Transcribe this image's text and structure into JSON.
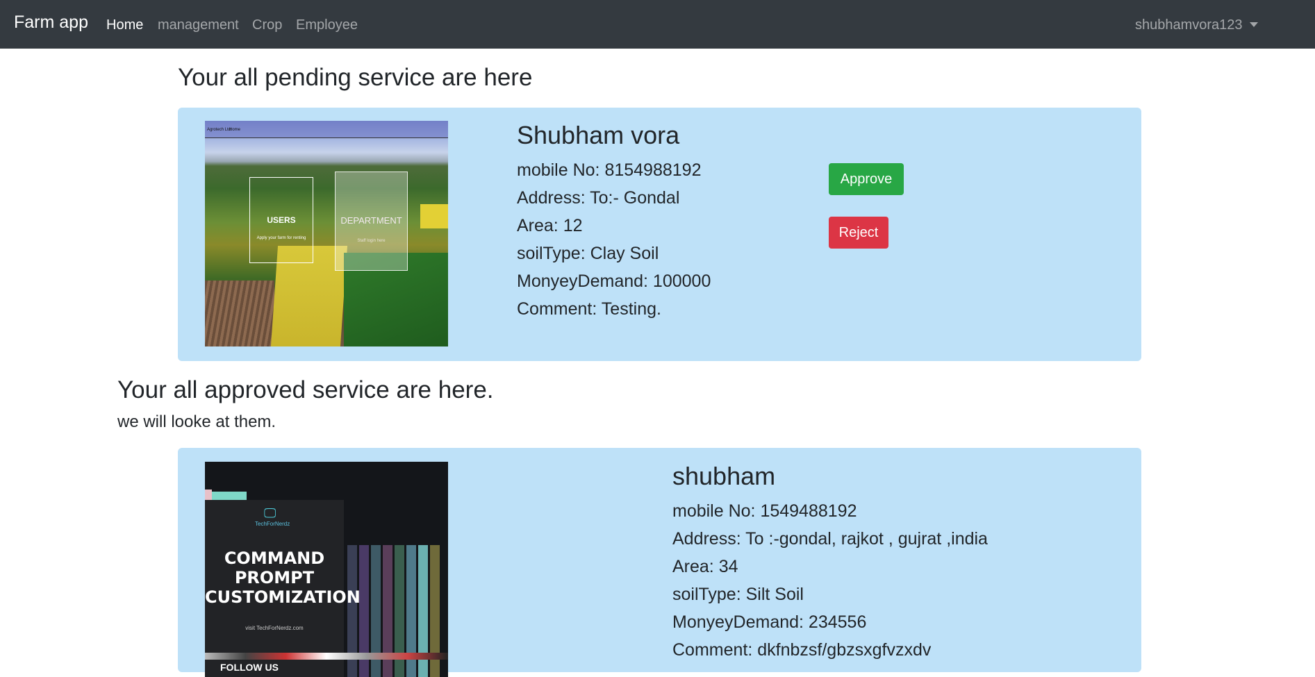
{
  "navbar": {
    "brand": "Farm app",
    "links": [
      {
        "label": "Home",
        "active": true
      },
      {
        "label": "management",
        "active": false
      },
      {
        "label": "Crop",
        "active": false
      },
      {
        "label": "Employee",
        "active": false
      }
    ],
    "user": "shubhamvora123"
  },
  "pending": {
    "heading": "Your all pending service are here",
    "items": [
      {
        "name": "Shubham vora",
        "mobile": "mobile No: 8154988192",
        "address": "Address: To:- Gondal",
        "area": "Area: 12",
        "soil": "soilType: Clay Soil",
        "money": "MonyeyDemand: 100000",
        "comment": "Comment: Testing.",
        "approve_label": "Approve",
        "reject_label": "Reject",
        "image": {
          "header_brand": "Agrotech Ltd.",
          "header_link": "Home",
          "box1_title": "USERS",
          "box1_sub": "Apply your farm for renting",
          "box2_title": "DEPARTMENT",
          "box2_sub": "Staff login here"
        }
      }
    ]
  },
  "approved": {
    "heading": "Your all approved service are here.",
    "subheading": "we will looke at them.",
    "items": [
      {
        "name": "shubham",
        "mobile": "mobile No: 1549488192",
        "address": "Address: To :-gondal, rajkot , gujrat ,india",
        "area": "Area: 34",
        "soil": "soilType: Silt Soil",
        "money": "MonyeyDemand: 234556",
        "comment": "Comment: dkfnbzsf/gbzsxgfvzxdv",
        "image": {
          "logo_text": "TechForNerdz",
          "title": "COMMAND PROMPT CUSTOMIZATION",
          "visit": "visit TechForNerdz.com",
          "follow": "FOLLOW US"
        }
      }
    ]
  }
}
